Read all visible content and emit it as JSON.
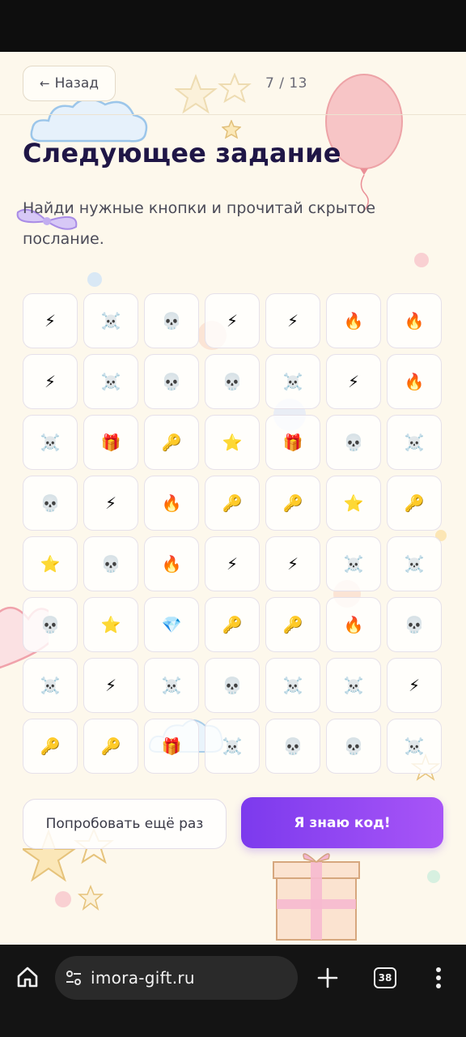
{
  "header": {
    "back_label": "Назад",
    "back_arrow": "←",
    "progress": "7 / 13"
  },
  "main": {
    "title": "Следующее задание",
    "description": "Найди нужные кнопки и прочитай скрытое послание."
  },
  "grid": [
    [
      "⚡",
      "☠️",
      "💀",
      "⚡",
      "⚡",
      "🔥",
      "🔥"
    ],
    [
      "⚡",
      "☠️",
      "💀",
      "💀",
      "☠️",
      "⚡",
      "🔥"
    ],
    [
      "☠️",
      "🎁",
      "🔑",
      "⭐",
      "🎁",
      "💀",
      "☠️"
    ],
    [
      "💀",
      "⚡",
      "🔥",
      "🔑",
      "🔑",
      "⭐",
      "🔑"
    ],
    [
      "⭐",
      "💀",
      "🔥",
      "⚡",
      "⚡",
      "☠️",
      "☠️"
    ],
    [
      "💀",
      "⭐",
      "💎",
      "🔑",
      "🔑",
      "🔥",
      "💀"
    ],
    [
      "☠️",
      "⚡",
      "☠️",
      "💀",
      "☠️",
      "☠️",
      "⚡"
    ],
    [
      "🔑",
      "🔑",
      "🎁",
      "☠️",
      "💀",
      "💀",
      "☠️"
    ]
  ],
  "actions": {
    "retry_label": "Попробовать ещё раз",
    "code_label": "Я знаю код!"
  },
  "browser": {
    "url": "imora-gift.ru",
    "tab_count": "38",
    "icons": [
      "home-icon",
      "tune-icon",
      "plus-icon",
      "tabs-icon",
      "more-vert-icon"
    ]
  },
  "colors": {
    "accent_start": "#7c3aed",
    "accent_end": "#a855f7",
    "title": "#1f1646",
    "background": "#fdf8ec"
  }
}
